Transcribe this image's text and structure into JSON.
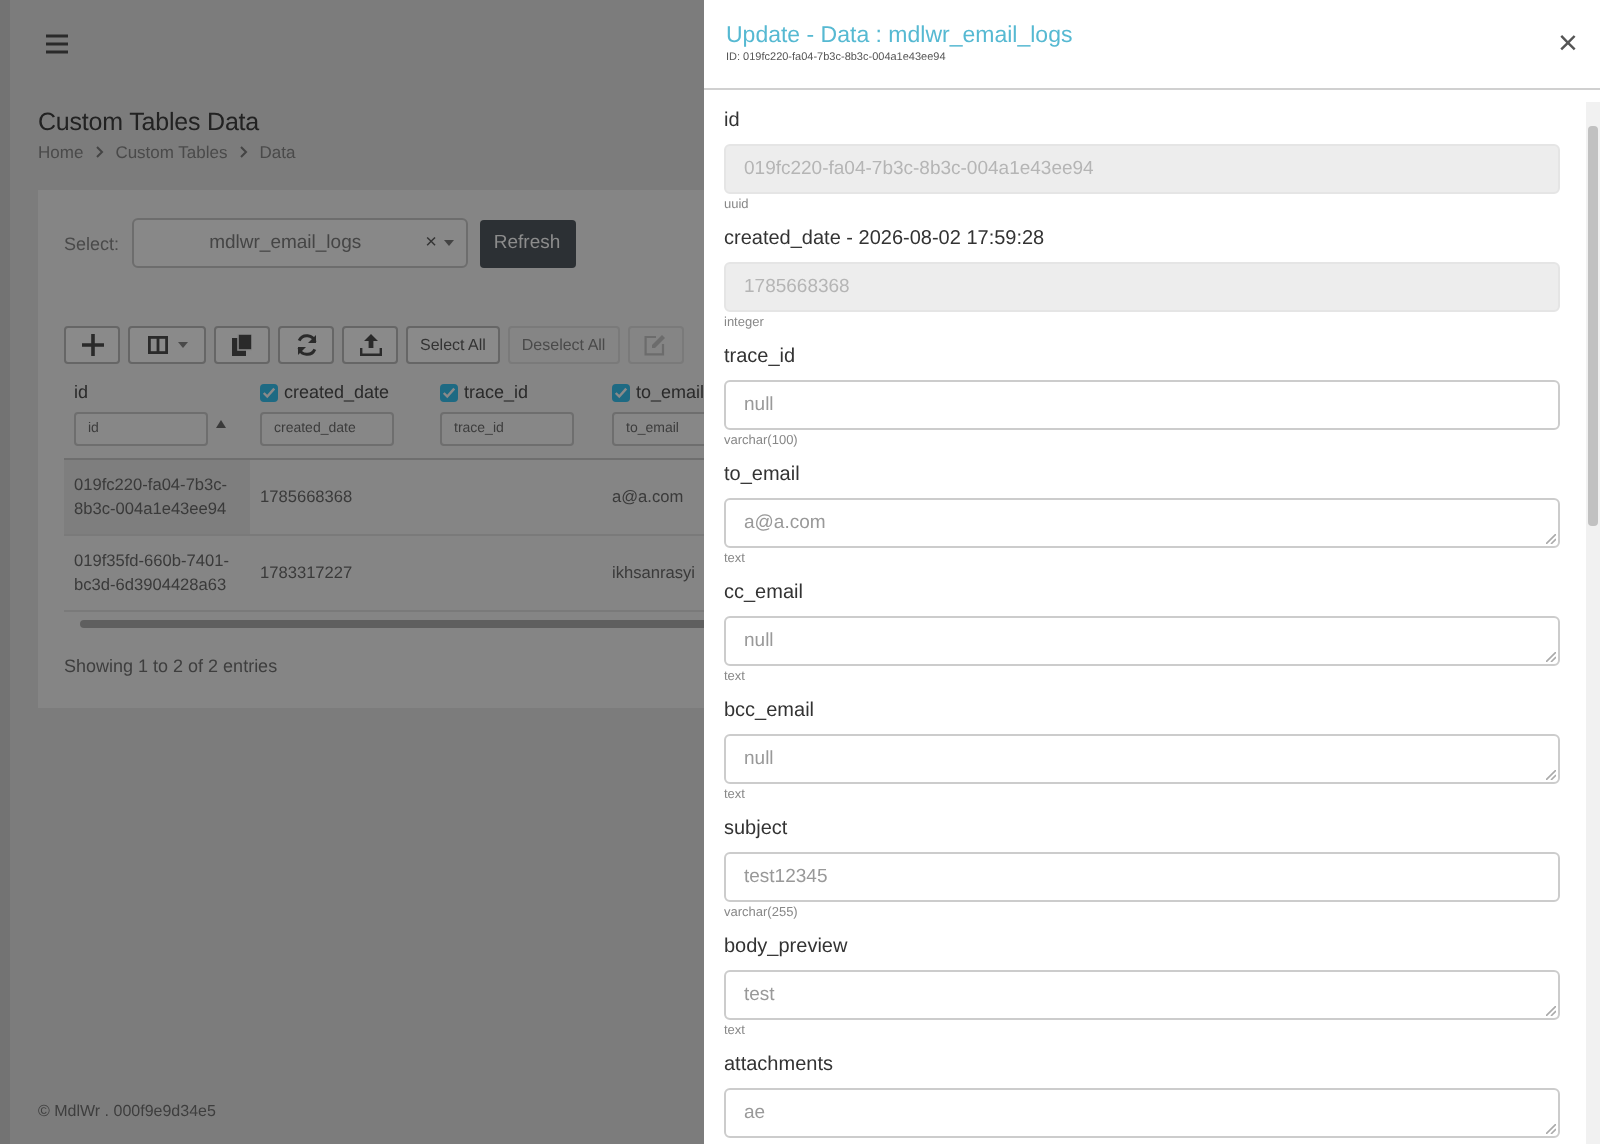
{
  "page": {
    "title": "Custom Tables Data",
    "breadcrumb": [
      "Home",
      "Custom Tables",
      "Data"
    ],
    "select_label": "Select:",
    "select_value": "mdlwr_email_logs",
    "clear_icon": "×",
    "refresh_button": "Refresh",
    "toolbar": [
      {
        "kind": "add",
        "disabled": false
      },
      {
        "kind": "columns",
        "disabled": false
      },
      {
        "kind": "copy",
        "disabled": false
      },
      {
        "kind": "refresh",
        "disabled": false
      },
      {
        "kind": "export",
        "disabled": false
      },
      {
        "kind": "text",
        "label": "Select All",
        "disabled": false
      },
      {
        "kind": "text",
        "label": "Deselect All",
        "disabled": true
      },
      {
        "kind": "edit",
        "disabled": true
      }
    ],
    "table": {
      "columns": [
        {
          "label": "id",
          "filter_placeholder": "id",
          "sorted": true
        },
        {
          "label": "created_date",
          "filter_placeholder": "created_date",
          "checked": true,
          "sorted": false
        },
        {
          "label": "trace_id",
          "filter_placeholder": "trace_id",
          "checked": true,
          "sorted": false
        },
        {
          "label": "to_email",
          "filter_placeholder": "to_email",
          "checked": true,
          "sorted": false
        }
      ],
      "rows": [
        [
          "019fc220-fa04-7b3c-8b3c-004a1e43ee94",
          "1785668368",
          "",
          "a@a.com"
        ],
        [
          "019f35fd-660b-7401-bc3d-6d3904428a63",
          "1783317227",
          "",
          "ikhsanrasyi"
        ]
      ]
    },
    "info": "Showing 1 to 2 of 2 entries",
    "footer": "© MdlWr . 000f9e9d34e5"
  },
  "panel": {
    "title": "Update - Data : mdlwr_email_logs",
    "subtitle": "ID: 019fc220-fa04-7b3c-8b3c-004a1e43ee94",
    "close": "×",
    "fields": [
      {
        "label": "id",
        "kind": "input",
        "value": "019fc220-fa04-7b3c-8b3c-004a1e43ee94",
        "hint": "uuid",
        "disabled": true
      },
      {
        "label": "created_date - 2026-08-02 17:59:28",
        "kind": "input",
        "value": "1785668368",
        "hint": "integer",
        "disabled": true
      },
      {
        "label": "trace_id",
        "kind": "input",
        "value": "null",
        "hint": "varchar(100)",
        "disabled": false
      },
      {
        "label": "to_email",
        "kind": "textarea",
        "value": "a@a.com",
        "hint": "text",
        "disabled": false
      },
      {
        "label": "cc_email",
        "kind": "textarea",
        "value": "null",
        "hint": "text",
        "disabled": false
      },
      {
        "label": "bcc_email",
        "kind": "textarea",
        "value": "null",
        "hint": "text",
        "disabled": false
      },
      {
        "label": "subject",
        "kind": "input",
        "value": "test12345",
        "hint": "varchar(255)",
        "disabled": false
      },
      {
        "label": "body_preview",
        "kind": "textarea",
        "value": "test",
        "hint": "text",
        "disabled": false
      },
      {
        "label": "attachments",
        "kind": "textarea",
        "value": "ae",
        "disabled": false
      }
    ]
  }
}
